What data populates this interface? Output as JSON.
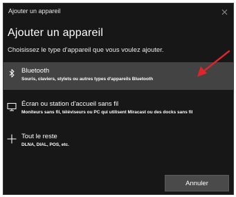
{
  "window": {
    "title": "Ajouter un appareil",
    "close_icon": "close-icon"
  },
  "header": {
    "title": "Ajouter un appareil",
    "subtitle": "Choisissez le type d’appareil que vous voulez ajouter."
  },
  "options": [
    {
      "icon": "bluetooth-icon",
      "title": "Bluetooth",
      "description": "Souris, claviers, stylets ou autres types d'appareils Bluetooth",
      "selected": true
    },
    {
      "icon": "monitor-icon",
      "title": "Écran ou station d'accueil sans fil",
      "description": "Moniteurs sans fil, téléviseurs ou PC qui utilisent Miracast ou des docks sans fil",
      "selected": false
    },
    {
      "icon": "plus-icon",
      "title": "Tout le reste",
      "description": "DLNA, DIAL, POS, etc.",
      "selected": false
    }
  ],
  "annotation": {
    "arrow_color": "#e0252a"
  },
  "footer": {
    "cancel_label": "Annuler"
  },
  "colors": {
    "background": "#171717",
    "selected_row": "#434343",
    "button": "#4a4a4a"
  }
}
